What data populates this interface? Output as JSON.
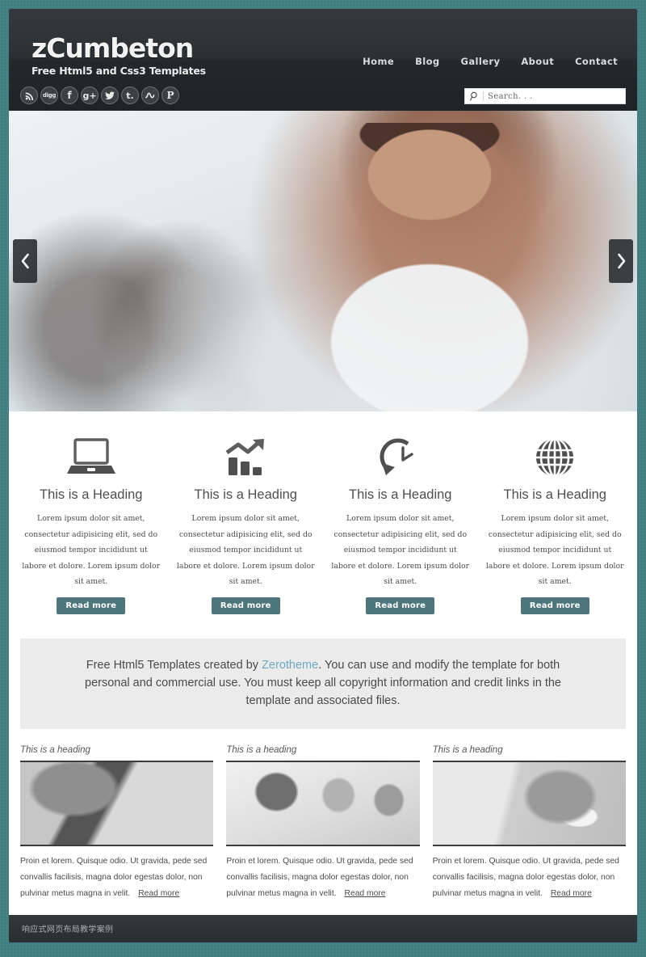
{
  "site": {
    "brand_title": "zCumbeton",
    "brand_tagline": "Free Html5 and Css3 Templates"
  },
  "nav": {
    "items": [
      {
        "label": "Home"
      },
      {
        "label": "Blog"
      },
      {
        "label": "Gallery"
      },
      {
        "label": "About"
      },
      {
        "label": "Contact"
      }
    ]
  },
  "social": {
    "items": [
      {
        "name": "rss-icon",
        "glyph": ""
      },
      {
        "name": "digg-icon",
        "glyph": "digg"
      },
      {
        "name": "facebook-icon",
        "glyph": "f"
      },
      {
        "name": "google-plus-icon",
        "glyph": "g+"
      },
      {
        "name": "twitter-icon",
        "glyph": ""
      },
      {
        "name": "tumblr-icon",
        "glyph": "t."
      },
      {
        "name": "stumbleupon-icon",
        "glyph": "su"
      },
      {
        "name": "pinterest-icon",
        "glyph": "P"
      }
    ]
  },
  "search": {
    "placeholder": "Search. . .",
    "value": "",
    "icon": "search-icon"
  },
  "slider": {
    "prev_label": "‹",
    "next_label": "›",
    "image_alt": "Smiling woman in white coat with blurred office background"
  },
  "features": [
    {
      "icon": "laptop-icon",
      "title": "This is a Heading",
      "text": "Lorem ipsum dolor sit amet, consectetur adipisicing elit, sed do eiusmod tempor incididunt ut labore et dolore. Lorem ipsum dolor sit amet.",
      "button": "Read more"
    },
    {
      "icon": "bar-chart-arrow-icon",
      "title": "This is a Heading",
      "text": "Lorem ipsum dolor sit amet, consectetur adipisicing elit, sed do eiusmod tempor incididunt ut labore et dolore. Lorem ipsum dolor sit amet.",
      "button": "Read more"
    },
    {
      "icon": "clock-rewind-icon",
      "title": "This is a Heading",
      "text": "Lorem ipsum dolor sit amet, consectetur adipisicing elit, sed do eiusmod tempor incididunt ut labore et dolore. Lorem ipsum dolor sit amet.",
      "button": "Read more"
    },
    {
      "icon": "globe-icon",
      "title": "This is a Heading",
      "text": "Lorem ipsum dolor sit amet, consectetur adipisicing elit, sed do eiusmod tempor incididunt ut labore et dolore. Lorem ipsum dolor sit amet.",
      "button": "Read more"
    }
  ],
  "callout": {
    "part1": "Free Html5 Templates created by ",
    "link": "Zerotheme",
    "part2": ". You can use and modify the template for both personal and commercial use. You must keep all copyright information and credit links in the template and associated files."
  },
  "blog": [
    {
      "heading": "This is a heading",
      "thumb": "hand-holding-credit-card-over-laptop",
      "text": "Proin et lorem. Quisque odio. Ut gravida, pede sed convallis facilisis, magna dolor egestas dolor, non pulvinar metus magna in velit.",
      "readmore": "Read more"
    },
    {
      "heading": "This is a heading",
      "thumb": "female-doctor-with-stethoscope-and-staff",
      "text": "Proin et lorem. Quisque odio. Ut gravida, pede sed convallis facilisis, magna dolor egestas dolor, non pulvinar metus magna in velit.",
      "readmore": "Read more"
    },
    {
      "heading": "This is a heading",
      "thumb": "person-writing-on-notepad-overhead",
      "text": "Proin et lorem. Quisque odio. Ut gravida, pede sed convallis facilisis, magna dolor egestas dolor, non pulvinar metus magna in velit.",
      "readmore": "Read more"
    }
  ],
  "footer": {
    "text": "响应式网页布局教学案例"
  },
  "colors": {
    "page_background": "#3f7d80",
    "header_background": "#2a2f33",
    "accent_button": "#4d767c",
    "callout_background": "#ebebeb",
    "callout_link": "#6ea9c4",
    "footer_background": "#2c3134"
  }
}
